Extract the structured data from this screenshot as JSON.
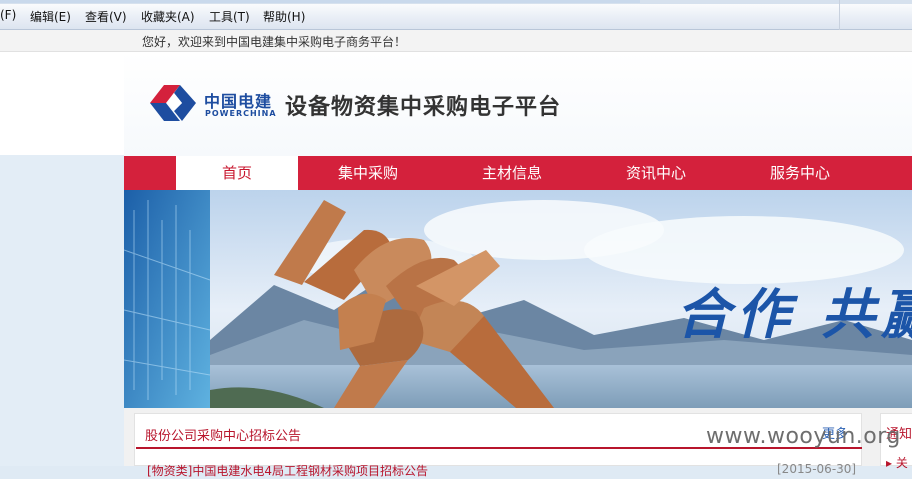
{
  "menubar": {
    "items": [
      "(F)",
      "编辑(E)",
      "查看(V)",
      "收藏夹(A)",
      "工具(T)",
      "帮助(H)"
    ]
  },
  "welcome": {
    "text": "您好，欢迎来到中国电建集中采购电子商务平台！"
  },
  "header": {
    "logo_cn": "中国电建",
    "logo_en": "POWERCHINA",
    "title": "设备物资集中采购电子平台",
    "brand_colors": {
      "red": "#d4213c",
      "blue": "#1e4da0"
    }
  },
  "nav": {
    "items": [
      "首页",
      "集中采购",
      "主材信息",
      "资讯中心",
      "服务中心"
    ],
    "active_index": 0
  },
  "banner": {
    "slogan": "合作 共赢"
  },
  "announcements": {
    "title": "股份公司采购中心招标公告",
    "more": "更多",
    "items": [
      {
        "text": "[物资类]中国电建水电4局工程钢材采购项目招标公告",
        "date": "[2015-06-30]"
      }
    ]
  },
  "side_panel": {
    "title": "通知",
    "items": [
      "关"
    ]
  },
  "watermark": "www.wooyun.org"
}
